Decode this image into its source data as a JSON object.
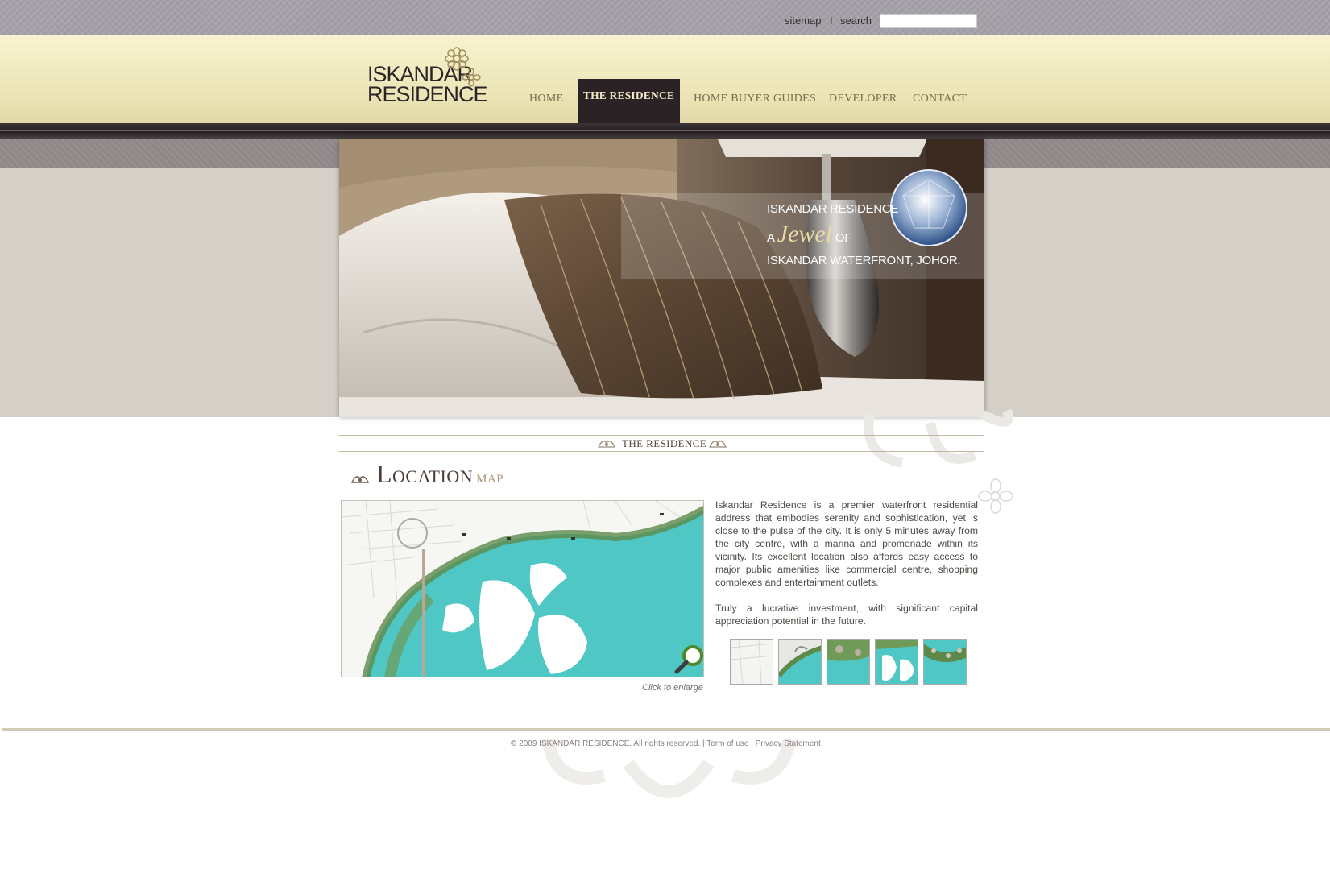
{
  "utility": {
    "sitemap": "sitemap",
    "separator": "I",
    "search": "search",
    "search_value": ""
  },
  "logo": {
    "line1": "ISKANDAR",
    "line2": "RESIDENCE"
  },
  "nav": {
    "home": "HOME",
    "residence": "THE RESIDENCE",
    "guides": "HOME BUYER GUIDES",
    "developer": "DEVELOPER",
    "contact": "CONTACT"
  },
  "hero": {
    "line1": "ISKANDAR RESIDENCE",
    "line2_prefix": "A",
    "line2_word": "Jewel",
    "line2_suffix": "OF",
    "line3": "ISKANDAR WATERFRONT, JOHOR."
  },
  "section": {
    "title": "THE RESIDENCE",
    "heading": "Location",
    "heading_accent": "map"
  },
  "map": {
    "caption": "Click to enlarge"
  },
  "description": {
    "p1": "Iskandar Residence is a premier waterfront residential address that embodies serenity and sophistication, yet is close to the pulse of the city. It is only 5 minutes away from the city centre, with a marina and promenade within its vicinity. Its excellent location also affords easy access to major public amenities like commercial centre, shopping complexes and entertainment outlets.",
    "p2": "Truly a lucrative investment, with significant capital appreciation potential in the future."
  },
  "footer": {
    "text": "© 2009 ISKANDAR RESIDENCE. All rights reserved. | Term of use | Privacy Statement"
  },
  "colors": {
    "nav_active_bg": "#2a2224",
    "header_bg": "#f2ecc2",
    "water": "#4fc7c4",
    "heading_dark": "#4a3b35",
    "heading_accent": "#a89670"
  },
  "icons": [
    "flower-logo-icon",
    "diamond-icon",
    "magnifier-icon",
    "ornament-icon"
  ]
}
